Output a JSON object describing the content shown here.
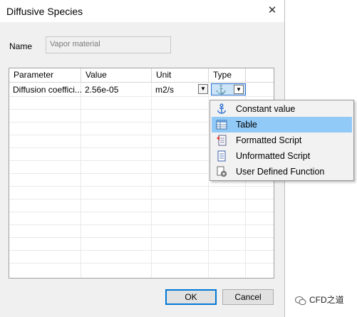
{
  "window": {
    "title": "Diffusive Species"
  },
  "form": {
    "name_label": "Name",
    "name_value": "Vapor material"
  },
  "table": {
    "headers": [
      "Parameter",
      "Value",
      "Unit",
      "Type"
    ],
    "rows": [
      {
        "parameter": "Diffusion coeffici...",
        "value": "2.56e-05",
        "unit": "m2/s"
      }
    ]
  },
  "type_menu": {
    "items": [
      {
        "label": "Constant value",
        "icon": "anchor-icon"
      },
      {
        "label": "Table",
        "icon": "table-icon"
      },
      {
        "label": "Formatted Script",
        "icon": "formatted-script-icon"
      },
      {
        "label": "Unformatted Script",
        "icon": "unformatted-script-icon"
      },
      {
        "label": "User Defined Function",
        "icon": "user-function-icon"
      }
    ],
    "selected": "Table"
  },
  "buttons": {
    "ok": "OK",
    "cancel": "Cancel"
  },
  "watermark": {
    "text": "CFD之道"
  }
}
